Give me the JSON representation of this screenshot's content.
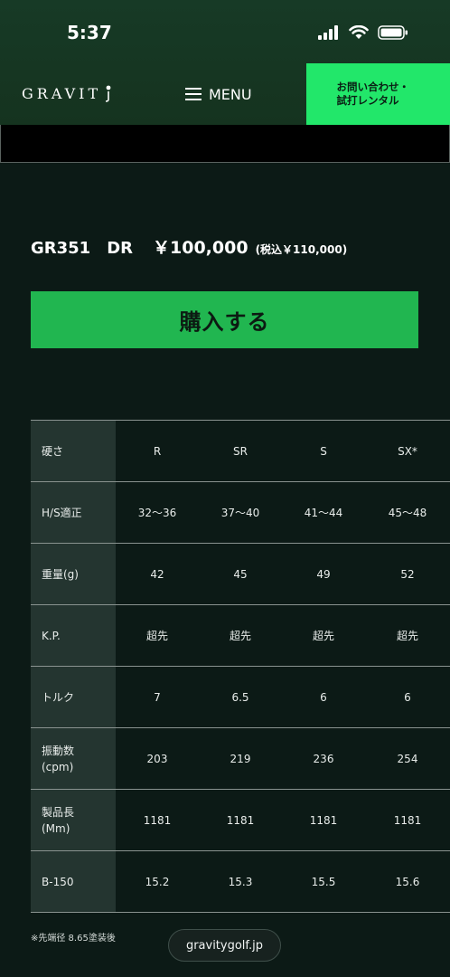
{
  "status_bar": {
    "time": "5:37"
  },
  "header": {
    "logo": "GRAVIT",
    "menu_label": "MENU",
    "contact_label_line1": "お問い合わせ・",
    "contact_label_line2": "試打レンタル"
  },
  "product": {
    "name": "GR351　DR",
    "price": "￥100,000",
    "tax_note": "(税込￥110,000)",
    "buy_label": "購入する"
  },
  "spec_table": {
    "rows": [
      {
        "label": "硬さ",
        "values": [
          "R",
          "SR",
          "S",
          "SX*"
        ]
      },
      {
        "label": "H/S適正",
        "values": [
          "32〜36",
          "37〜40",
          "41〜44",
          "45〜48"
        ]
      },
      {
        "label": "重量(g)",
        "values": [
          "42",
          "45",
          "49",
          "52"
        ]
      },
      {
        "label": "K.P.",
        "values": [
          "超先",
          "超先",
          "超先",
          "超先"
        ]
      },
      {
        "label": "トルク",
        "values": [
          "7",
          "6.5",
          "6",
          "6"
        ]
      },
      {
        "label_line1": "振動数",
        "label_line2": "(cpm)",
        "values": [
          "203",
          "219",
          "236",
          "254"
        ]
      },
      {
        "label_line1": "製品長",
        "label_line2": "(Mm)",
        "values": [
          "1181",
          "1181",
          "1181",
          "1181"
        ]
      },
      {
        "label": "B-150",
        "values": [
          "15.2",
          "15.3",
          "15.5",
          "15.6"
        ]
      }
    ]
  },
  "footer": {
    "footnote": "※先端径 8.65塗装後",
    "domain": "gravitygolf.jp"
  },
  "colors": {
    "accent_green": "#22e76a",
    "buy_green": "#21b650",
    "background": "#0c1a16",
    "header_band": "#173a26"
  },
  "icons": [
    "signal-icon",
    "wifi-icon",
    "battery-icon",
    "hamburger-icon",
    "logo-mark-icon"
  ]
}
